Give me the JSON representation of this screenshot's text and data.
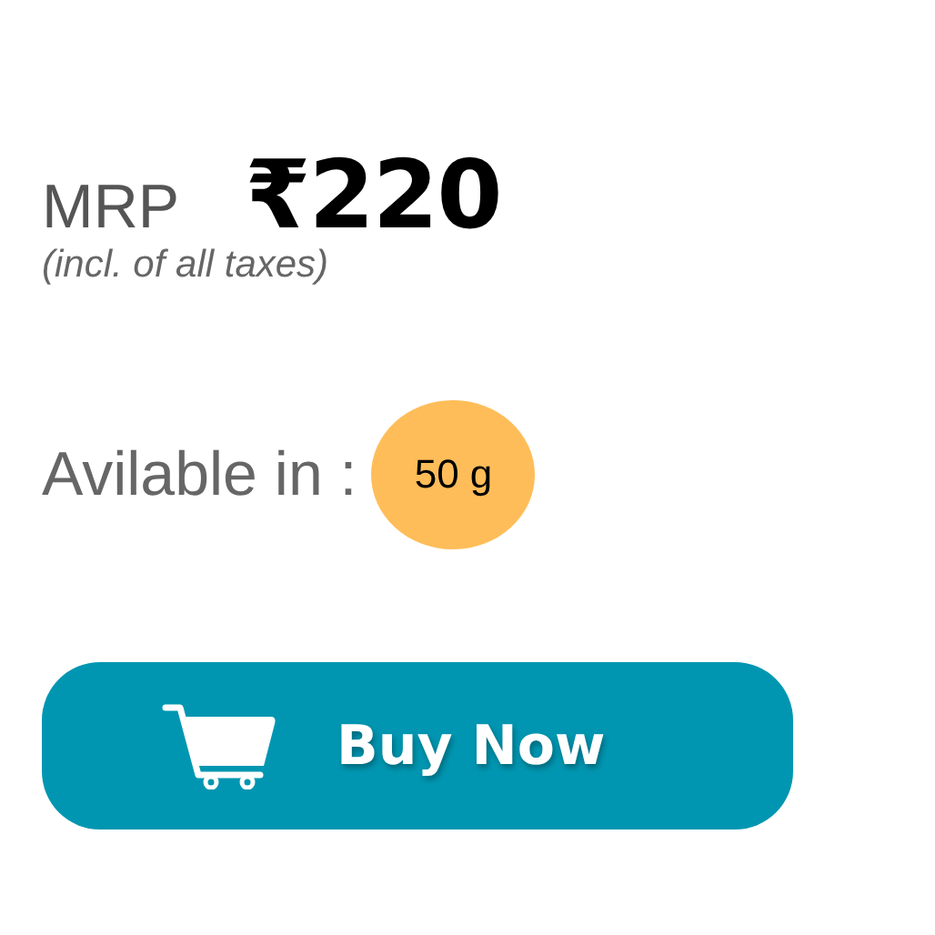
{
  "price": {
    "label": "MRP",
    "amount": "₹220",
    "note": "(incl. of all taxes)"
  },
  "availability": {
    "label": "Avilable in :",
    "sizes": [
      "50 g"
    ]
  },
  "buy_button": {
    "label": "Buy Now"
  }
}
